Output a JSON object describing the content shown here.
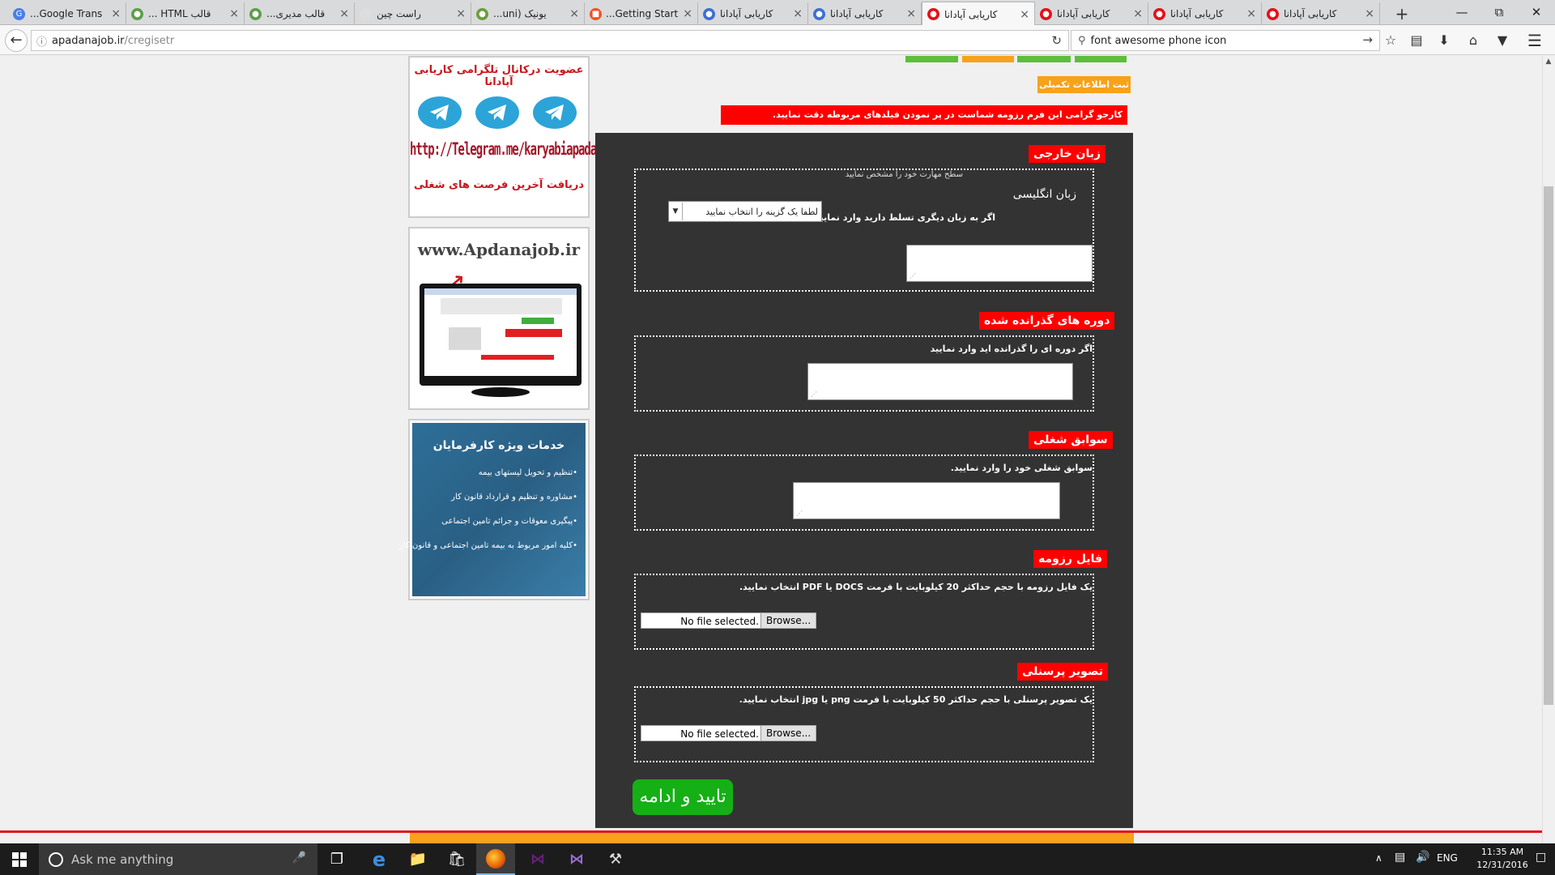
{
  "browser": {
    "tabs": [
      {
        "title": "Google Trans...",
        "favicon_color": "#4a7de8",
        "favicon": "G"
      },
      {
        "title": "قالب HTML ...",
        "favicon_color": "#5d9e4b",
        "favicon": "●"
      },
      {
        "title": "قالب مدیری...",
        "favicon_color": "#5d9e4b",
        "favicon": "●"
      },
      {
        "title": "راست چین",
        "favicon_color": "#dddddd",
        "favicon": ""
      },
      {
        "title": "یونیک (uni...",
        "favicon_color": "#6a9e3b",
        "favicon": "●"
      },
      {
        "title": "Getting Start...",
        "favicon_color": "#f25022",
        "favicon": "■"
      },
      {
        "title": "کاریابی آپادانا",
        "favicon_color": "#3b6fd6",
        "favicon": "●"
      },
      {
        "title": "کاریابی آپادانا",
        "favicon_color": "#3b6fd6",
        "favicon": "●"
      },
      {
        "title": "کاریابی آپادانا",
        "favicon_color": "#e5101b",
        "favicon": "●"
      },
      {
        "title": "کاریابی آپادانا",
        "favicon_color": "#e5101b",
        "favicon": "●"
      },
      {
        "title": "کاریابی آپادانا",
        "favicon_color": "#e5101b",
        "favicon": "●"
      },
      {
        "title": "کاریابی آپادانا",
        "favicon_color": "#e5101b",
        "favicon": "●"
      }
    ],
    "active_tab": 8,
    "url_host": "apadanajob.ir",
    "url_path": "/cregisetr",
    "search_value": "font awesome phone icon"
  },
  "sidebar": {
    "telegram_title": "عضویت درکانال تلگرامی کاریابی آپادانا",
    "telegram_link": "http://Telegram.me/karyabiapadanaa",
    "telegram_caption": "دریافت آخرین فرصت های شغلی",
    "site_url": "www.Apdanajob.ir",
    "employer_title": "خدمات ویژه کارفرمایان",
    "employer_items": [
      "•تنظیم و تحویل لیستهای بیمه",
      "•مشاوره و تنظیم و قرارداد قانون کار",
      "•پیگیری معوقات و جرائم تامین اجتماعی",
      "•کلیه امور مربوط به بیمه تامین اجتماعی و قانون کار"
    ]
  },
  "form": {
    "complete_info_label": "ثبت اطلاعات تکمیلی",
    "warning": "کارجو گرامی این فرم رزومه شماست در پر نمودن فیلدهای مربوطه دقت نمایید.",
    "language": {
      "heading": "زبان خارجی",
      "hint": "سطح مهارت خود را مشخص نمایید",
      "label": "زبان انگلیسی",
      "other": "اگر به زبان دیگری تسلط دارید وارد نمایید.",
      "select_value": "لطفا یک گزینه را انتخاب نمایید"
    },
    "courses": {
      "heading": "دوره های گذرانده شده",
      "hint": "اگر دوره ای را گذرانده اید وارد نمایید"
    },
    "experience": {
      "heading": "سوابق شغلی",
      "hint": "سوابق شغلی خود را وارد نمایید."
    },
    "resume": {
      "heading": "فایل رزومه",
      "hint": "یک فایل رزومه با حجم حداکثر 20 کیلوبایت با فرمت DOCS یا PDF انتخاب نمایید.",
      "file_status": "No file selected.",
      "browse": "Browse..."
    },
    "photo": {
      "heading": "تصویر پرسنلی",
      "hint": "یک تصویر پرسنلی با حجم حداکثر 50 کیلوبایت با فرمت png یا jpg انتخاب نمایید.",
      "file_status": "No file selected.",
      "browse": "Browse..."
    },
    "submit": "تایید و ادامه"
  },
  "taskbar": {
    "search_placeholder": "Ask me anything",
    "lang": "ENG",
    "time": "11:35 AM",
    "date": "12/31/2016"
  },
  "colors": {
    "red": "#ff0000",
    "green": "#15b015",
    "orange": "#f7a21b",
    "panel": "#333333"
  }
}
